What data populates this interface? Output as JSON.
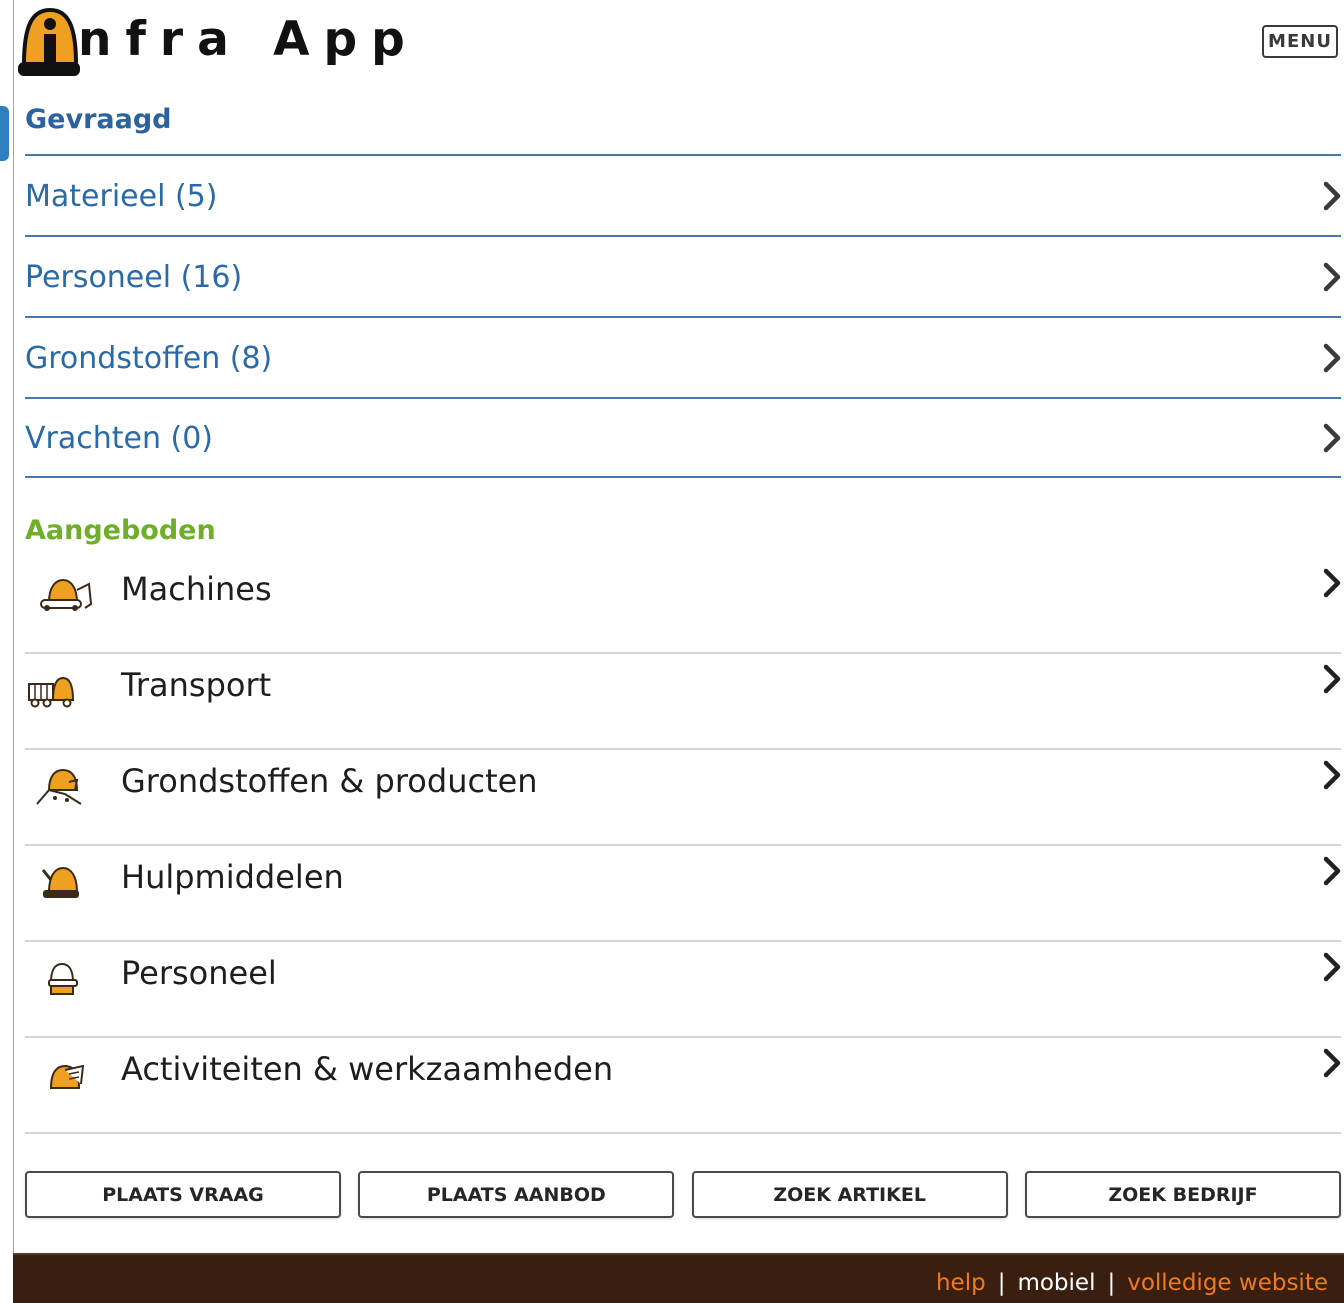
{
  "brand": {
    "logo_text": "nfra App",
    "logo_letter": "i",
    "accent": "#f0a020",
    "dark": "#111111"
  },
  "header": {
    "menu_label": "MENU"
  },
  "gevraagd": {
    "title": "Gevraagd",
    "color": "#2a63a0",
    "items": [
      {
        "label": "Materieel (5)"
      },
      {
        "label": "Personeel (16)"
      },
      {
        "label": "Grondstoffen (8)"
      },
      {
        "label": "Vrachten (0)"
      }
    ]
  },
  "aangeboden": {
    "title": "Aangeboden",
    "color": "#6fae2a",
    "items": [
      {
        "label": "Machines",
        "icon": "excavator-icon"
      },
      {
        "label": "Transport",
        "icon": "truck-icon"
      },
      {
        "label": "Grondstoffen & producten",
        "icon": "materials-icon"
      },
      {
        "label": "Hulpmiddelen",
        "icon": "tools-icon"
      },
      {
        "label": "Personeel",
        "icon": "worker-icon"
      },
      {
        "label": "Activiteiten & werkzaamheden",
        "icon": "activities-icon"
      }
    ]
  },
  "actions": {
    "plaats_vraag": "PLAATS VRAAG",
    "plaats_aanbod": "PLAATS AANBOD",
    "zoek_artikel": "ZOEK ARTIKEL",
    "zoek_bedrijf": "ZOEK BEDRIJF"
  },
  "footer": {
    "help": "help",
    "sep1": "|",
    "mobiel": "mobiel",
    "sep2": "|",
    "volledige": "volledige website",
    "background": "#3a1f10",
    "link_color": "#f07a1c"
  }
}
